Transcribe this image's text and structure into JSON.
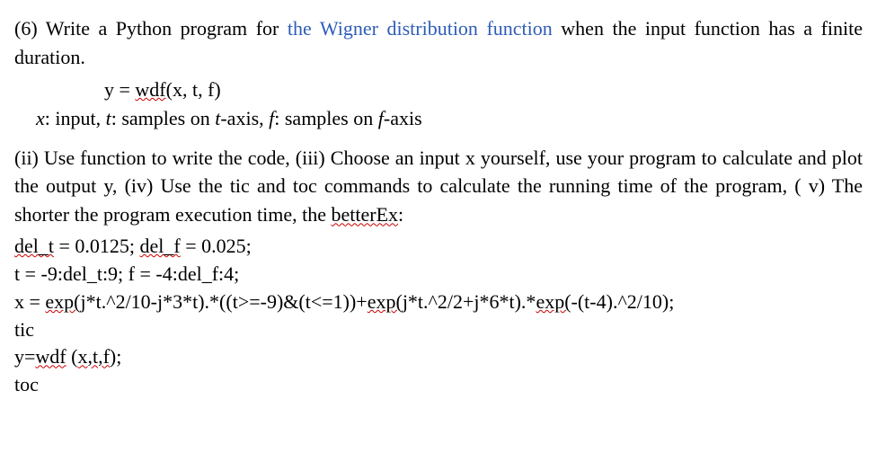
{
  "p1": {
    "prefix": "(6) Write a Python program for ",
    "link": "the Wigner distribution function",
    "suffix": " when the input function has a finite duration."
  },
  "eq": {
    "line_prefix": "y = ",
    "fn": "wdf",
    "line_suffix": "(x, t, f)"
  },
  "desc": {
    "x_var": "x",
    "x_txt": ": input, ",
    "t_var": "t",
    "t_txt": ": samples on ",
    "t_axis_var": "t",
    "t_axis_txt": "-axis, ",
    "f_var": "f",
    "f_txt": ": samples on ",
    "f_axis_var": "f",
    "f_axis_txt": "-axis"
  },
  "p2": {
    "a": "(ii) Use function to write the code, (iii) Choose an input x yourself, use your program to calculate and plot the output y, (iv) Use the tic and toc commands to calculate the running time of the program, ( v) The shorter the program execution time, the ",
    "better": "betterEx",
    "colon": ":"
  },
  "code": {
    "l1a": "del_t",
    "l1b": " = 0.0125;    ",
    "l1c": "del_f",
    "l1d": " = 0.025;",
    "l2": "t = -9:del_t:9;      f = -4:del_f:4;",
    "l3a": "x = ",
    "l3b": "exp(",
    "l3c": "j*t.^2/10-j*3*t).*((t>=-9)&(t<=1))+",
    "l3d": "exp(",
    "l3e": "j*t.^2/2+j*6*t).*",
    "l3f": "exp(",
    "l3g": "-(t-4).^2/10);",
    "l4": "tic",
    "l5a": "y=",
    "l5b": "wdf",
    "l5c": " (",
    "l5d": "x,t,f",
    "l5e": ");",
    "l6": "toc"
  }
}
